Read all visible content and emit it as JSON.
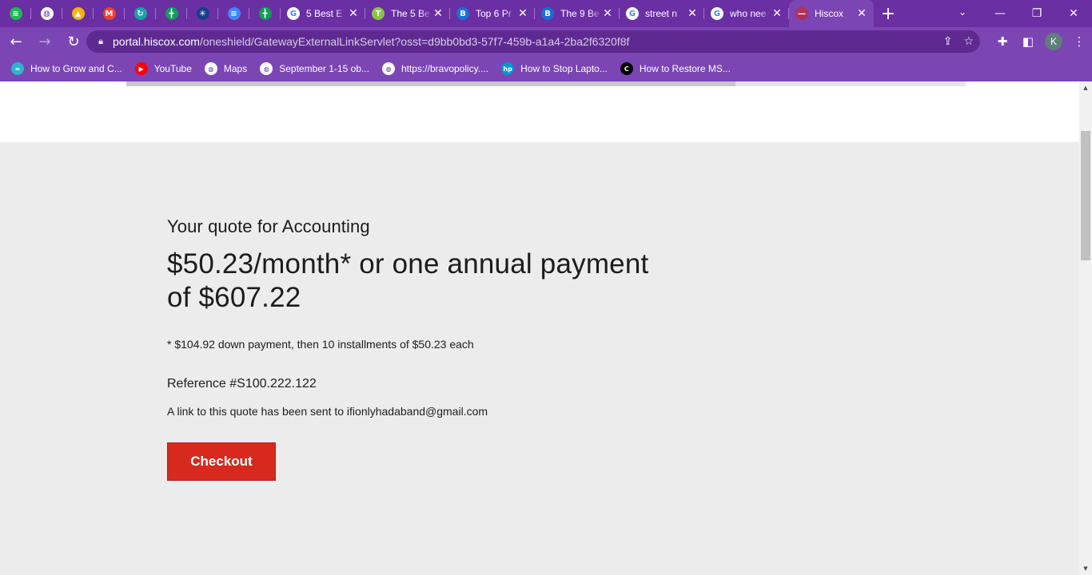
{
  "browser": {
    "pinned_tabs": [
      {
        "icon": "spotify-icon",
        "color": "#1db954",
        "glyph": "≋"
      },
      {
        "icon": "globe-icon",
        "color": "#ffffff",
        "glyph": "◍"
      },
      {
        "icon": "google-drive-icon",
        "color": "#f4b400",
        "glyph": "▲"
      },
      {
        "icon": "gmail-icon",
        "color": "#ea4335",
        "glyph": "M"
      },
      {
        "icon": "sync-icon",
        "color": "#1aa3a3",
        "glyph": "↻"
      },
      {
        "icon": "google-sheets-icon",
        "color": "#0f9d58",
        "glyph": "╋"
      },
      {
        "icon": "spider-icon",
        "color": "#1a3f8a",
        "glyph": "✳"
      },
      {
        "icon": "google-docs-icon",
        "color": "#4285f4",
        "glyph": "≡"
      },
      {
        "icon": "google-sheets-icon",
        "color": "#0f9d58",
        "glyph": "╋"
      }
    ],
    "tabs": [
      {
        "label": "5 Best E",
        "icon": "google-icon",
        "color": "#ffffff",
        "glyph": "G",
        "active": false
      },
      {
        "label": "The 5 Be",
        "icon": "tm-icon",
        "color": "#8bc34a",
        "glyph": "T",
        "active": false
      },
      {
        "label": "Top 6 Pr",
        "icon": "bp-icon",
        "color": "#1a6fd6",
        "glyph": "B",
        "active": false
      },
      {
        "label": "The 9 Be",
        "icon": "bp-icon",
        "color": "#1a6fd6",
        "glyph": "B",
        "active": false
      },
      {
        "label": "street n",
        "icon": "google-icon",
        "color": "#ffffff",
        "glyph": "G",
        "active": false
      },
      {
        "label": "who nee",
        "icon": "google-icon",
        "color": "#ffffff",
        "glyph": "G",
        "active": false
      },
      {
        "label": "Hiscox",
        "icon": "hiscox-icon",
        "color": "#b0305a",
        "glyph": "—",
        "active": true
      }
    ],
    "url_host": "portal.hiscox.com",
    "url_path": "/oneshield/GatewayExternalLinkServlet?osst=d9bb0bd3-57f7-459b-a1a4-2ba2f6320f8f",
    "profile_initial": "K",
    "bookmarks": [
      {
        "label": "How to Grow and C...",
        "icon": "ribbon-icon",
        "color": "#2bb6c9",
        "glyph": "≈"
      },
      {
        "label": "YouTube",
        "icon": "youtube-icon",
        "color": "#ff0000",
        "glyph": "▶"
      },
      {
        "label": "Maps",
        "icon": "globe-icon",
        "color": "#ffffff",
        "glyph": "◍"
      },
      {
        "label": "September 1-15 ob...",
        "icon": "globe-icon",
        "color": "#ffffff",
        "glyph": "◍"
      },
      {
        "label": "https://bravopolicy....",
        "icon": "globe-icon",
        "color": "#ffffff",
        "glyph": "◍"
      },
      {
        "label": "How to Stop Lapto...",
        "icon": "hp-icon",
        "color": "#0096d6",
        "glyph": "hp"
      },
      {
        "label": "How to Restore MS...",
        "icon": "c-icon",
        "color": "#000000",
        "glyph": "C"
      }
    ]
  },
  "page": {
    "progress_fraction": 0.726,
    "quote_for": "Your quote for Accounting",
    "price_line": "$50.23/month* or one annual payment of $607.22",
    "footnote": "* $104.92 down payment, then 10 installments of $50.23 each",
    "reference": "Reference #S100.222.122",
    "sent_notice": "A link to this quote has been sent to ifionlyhadaband@gmail.com",
    "checkout_label": "Checkout",
    "accent_color": "#d7291e"
  }
}
